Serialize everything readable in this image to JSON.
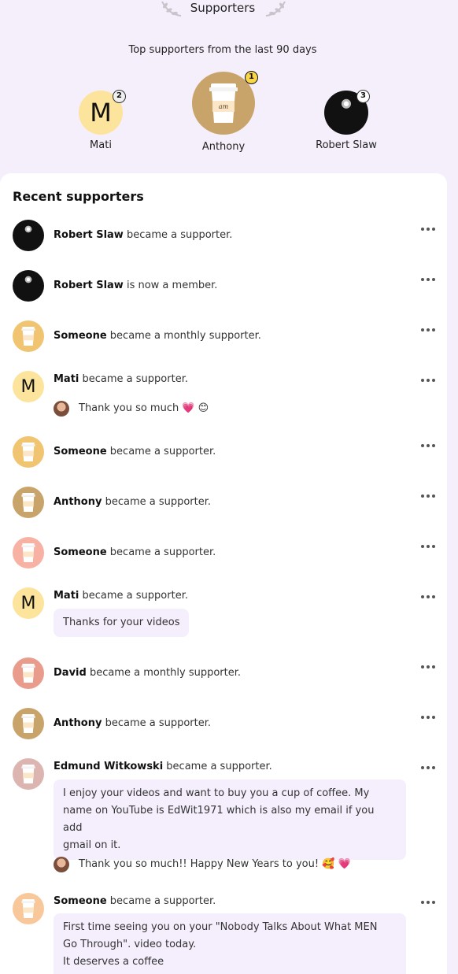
{
  "header": {
    "title": "Supporters",
    "subtitle": "Top supporters from the last 90 days"
  },
  "top_supporters": [
    {
      "name": "Mati",
      "rank": "2",
      "initial": "M"
    },
    {
      "name": "Anthony",
      "rank": "1",
      "cup_text": "am"
    },
    {
      "name": "Robert Slaw",
      "rank": "3"
    }
  ],
  "recent": {
    "title": "Recent supporters",
    "items": [
      {
        "name": "Robert Slaw",
        "action": " became a supporter."
      },
      {
        "name": "Robert Slaw",
        "action": " is now a member."
      },
      {
        "name": "Someone",
        "action": " became a monthly supporter."
      },
      {
        "name": "Mati",
        "action": " became a supporter.",
        "reply": "Thank you so much 💗 😊"
      },
      {
        "name": "Someone",
        "action": " became a supporter."
      },
      {
        "name": "Anthony",
        "action": " became a supporter."
      },
      {
        "name": "Someone",
        "action": " became a supporter."
      },
      {
        "name": "Mati",
        "action": " became a supporter.",
        "message": "Thanks for your videos"
      },
      {
        "name": "David",
        "action": " became a monthly supporter."
      },
      {
        "name": "Anthony",
        "action": " became a supporter."
      },
      {
        "name": "Edmund Witkowski",
        "action": " became a supporter.",
        "message_lines": [
          "I enjoy your videos and want to buy you a cup of coffee. My",
          "name on YouTube is EdWit1971 which is also my email if you add",
          "gmail on it."
        ],
        "reply": "Thank you so much!! Happy New Years to you! 🥰 💗"
      },
      {
        "name": "Someone",
        "action": " became a supporter.",
        "message_lines": [
          "First time seeing you on your \"Nobody Talks About What MEN",
          "Go Through\". video today.",
          "It deserves a coffee"
        ]
      }
    ]
  },
  "colors": {
    "page_bg": "#f5effb",
    "bubble_bg": "#f5effd",
    "cup_gold": "#c9a46a",
    "cup_yellow": "#f0c470",
    "cup_pink": "#f7b2a3",
    "cup_salmon": "#e99c8c",
    "cup_rose": "#dcb5b0",
    "cup_peach": "#f8c89a",
    "m_yellow": "#fde49c",
    "rank_gold": "#f9d648"
  },
  "icons": [
    "laurel-left-icon",
    "laurel-right-icon",
    "more-options-icon",
    "coffee-cup-icon"
  ]
}
